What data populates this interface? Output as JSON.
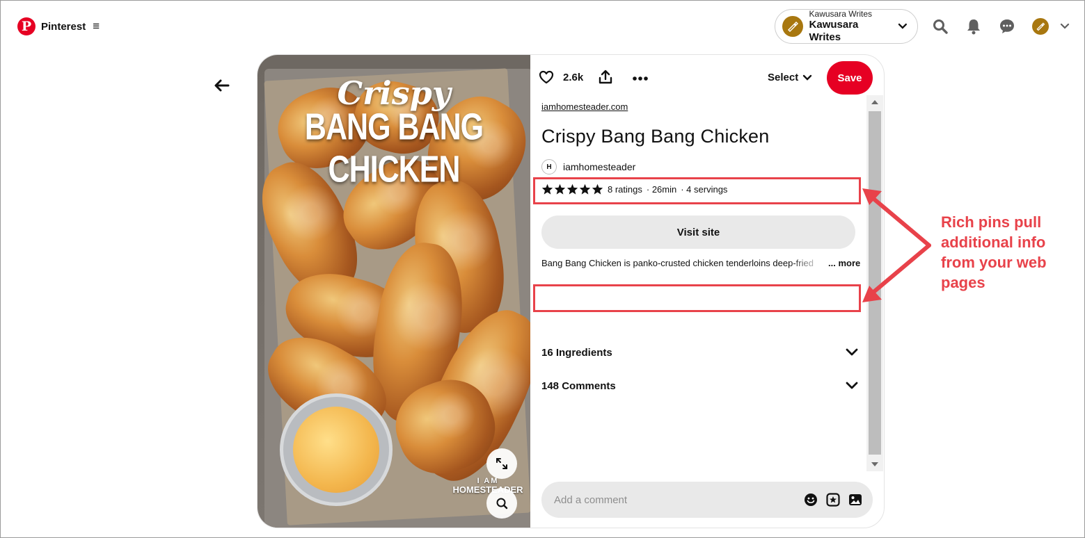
{
  "header": {
    "brand": "Pinterest",
    "account_small": "Kawusara Writes",
    "account_big": "Kawusara Writes",
    "icons": [
      "pinterest-logo",
      "menu-icon",
      "chevron-down-icon",
      "search-icon",
      "bell-icon",
      "chat-icon",
      "avatar",
      "chevron-down-icon"
    ]
  },
  "pin": {
    "image_text": {
      "title_line1": "Crispy",
      "title_line2": "BANG BANG CHICKEN",
      "watermark_line1": "I AM",
      "watermark_line2": "HOMESTEADER"
    },
    "like_count": "2.6k",
    "select_label": "Select",
    "save_label": "Save",
    "domain": "iamhomesteader.com",
    "title": "Crispy Bang Bang Chicken",
    "creator_initial": "H",
    "creator": "iamhomesteader",
    "rating_stars": 5,
    "ratings": "8 ratings",
    "time": "· 26min",
    "servings": "· 4 servings",
    "visit_label": "Visit site",
    "description": "Bang Bang Chicken is panko-crusted chicken tenderloins deep-fried",
    "more_label": "... more",
    "ingredients_label": "16 Ingredients",
    "comments_label": "148 Comments",
    "comment_placeholder": "Add a comment"
  },
  "annotation": {
    "text": "Rich pins pull additional info from your web pages",
    "color": "#e8424a"
  },
  "colors": {
    "brand_red": "#e60023",
    "button_gray": "#e9e9e9"
  }
}
